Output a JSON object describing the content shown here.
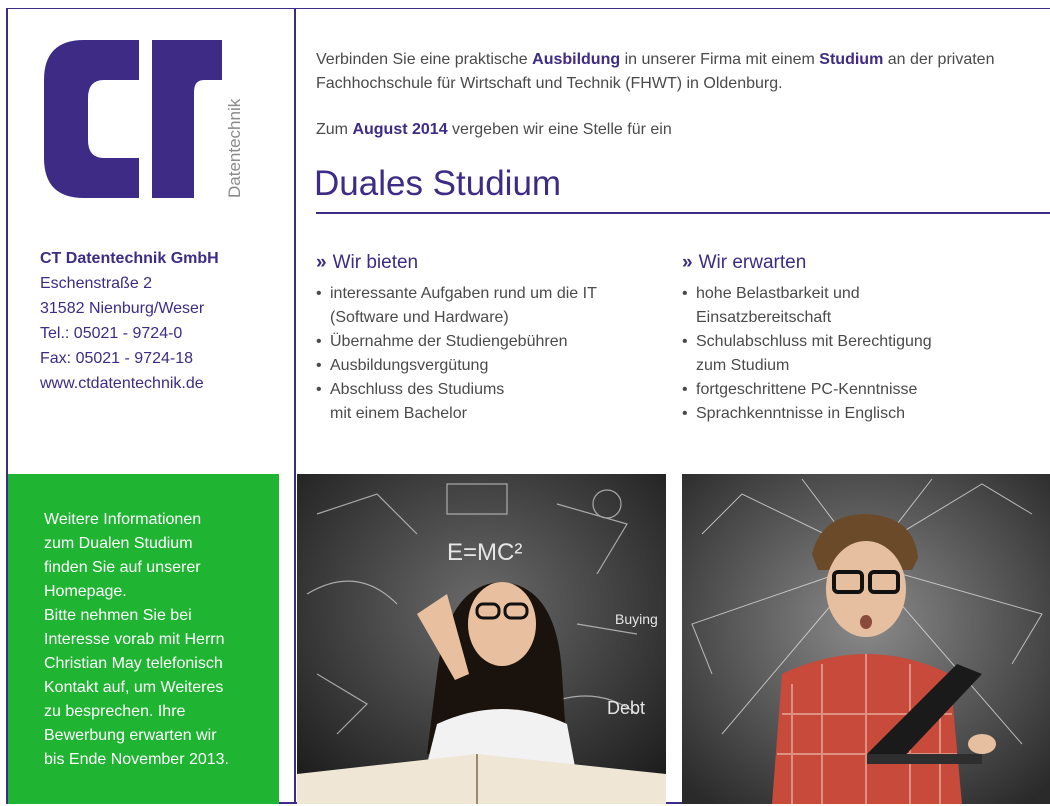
{
  "logo": {
    "letters": "CT",
    "subtitle": "Datentechnik"
  },
  "company": {
    "name": "CT Datentechnik GmbH",
    "lines": [
      "Eschenstraße 2",
      "31582 Nienburg/Weser",
      "Tel.:  05021 - 9724-0",
      "Fax:  05021 - 9724-18",
      "www.ctdatentechnik.de"
    ]
  },
  "info_box": {
    "lines": [
      "Weitere Informationen",
      "zum Dualen Studium",
      "finden Sie auf unserer",
      "Homepage.",
      "Bitte nehmen Sie bei",
      "Interesse vorab mit Herrn",
      "Christian May telefonisch",
      "Kontakt auf, um Weiteres",
      "zu besprechen. Ihre",
      "Bewerbung erwarten wir",
      "bis Ende November 2013."
    ]
  },
  "intro": {
    "p1_a": "Verbinden Sie eine praktische ",
    "p1_b": "Ausbildung",
    "p1_c": " in unserer Firma mit einem ",
    "p1_d": "Studium",
    "p1_e": " an der privaten Fachhochschule für Wirtschaft und Technik (FHWT) in Oldenburg.",
    "p2_a": "Zum ",
    "p2_b": "August 2014",
    "p2_c": " vergeben wir eine Stelle für ein"
  },
  "headline": "Duales Studium",
  "offer": {
    "chevron": "»",
    "title": "Wir bieten",
    "items": [
      [
        "interessante Aufgaben rund um die IT",
        "(Software und Hardware)"
      ],
      [
        "Übernahme der Studiengebühren"
      ],
      [
        "Ausbildungsvergütung"
      ],
      [
        "Abschluss des Studiums",
        "mit einem Bachelor"
      ]
    ]
  },
  "expect": {
    "chevron": "»",
    "title": "Wir erwarten",
    "items": [
      [
        "hohe Belastbarkeit und",
        "Einsatzbereitschaft"
      ],
      [
        "Schulabschluss mit Berechtigung",
        "zum Studium"
      ],
      [
        "fortgeschrittene PC-Kenntnisse"
      ],
      [
        "Sprachkenntnisse in Englisch"
      ]
    ]
  },
  "photos": {
    "one_texts": [
      "E=MC²",
      "Debt",
      "Buying"
    ]
  },
  "colors": {
    "brand": "#3e2b85",
    "green": "#1fb532",
    "text": "#4a4a4a"
  }
}
